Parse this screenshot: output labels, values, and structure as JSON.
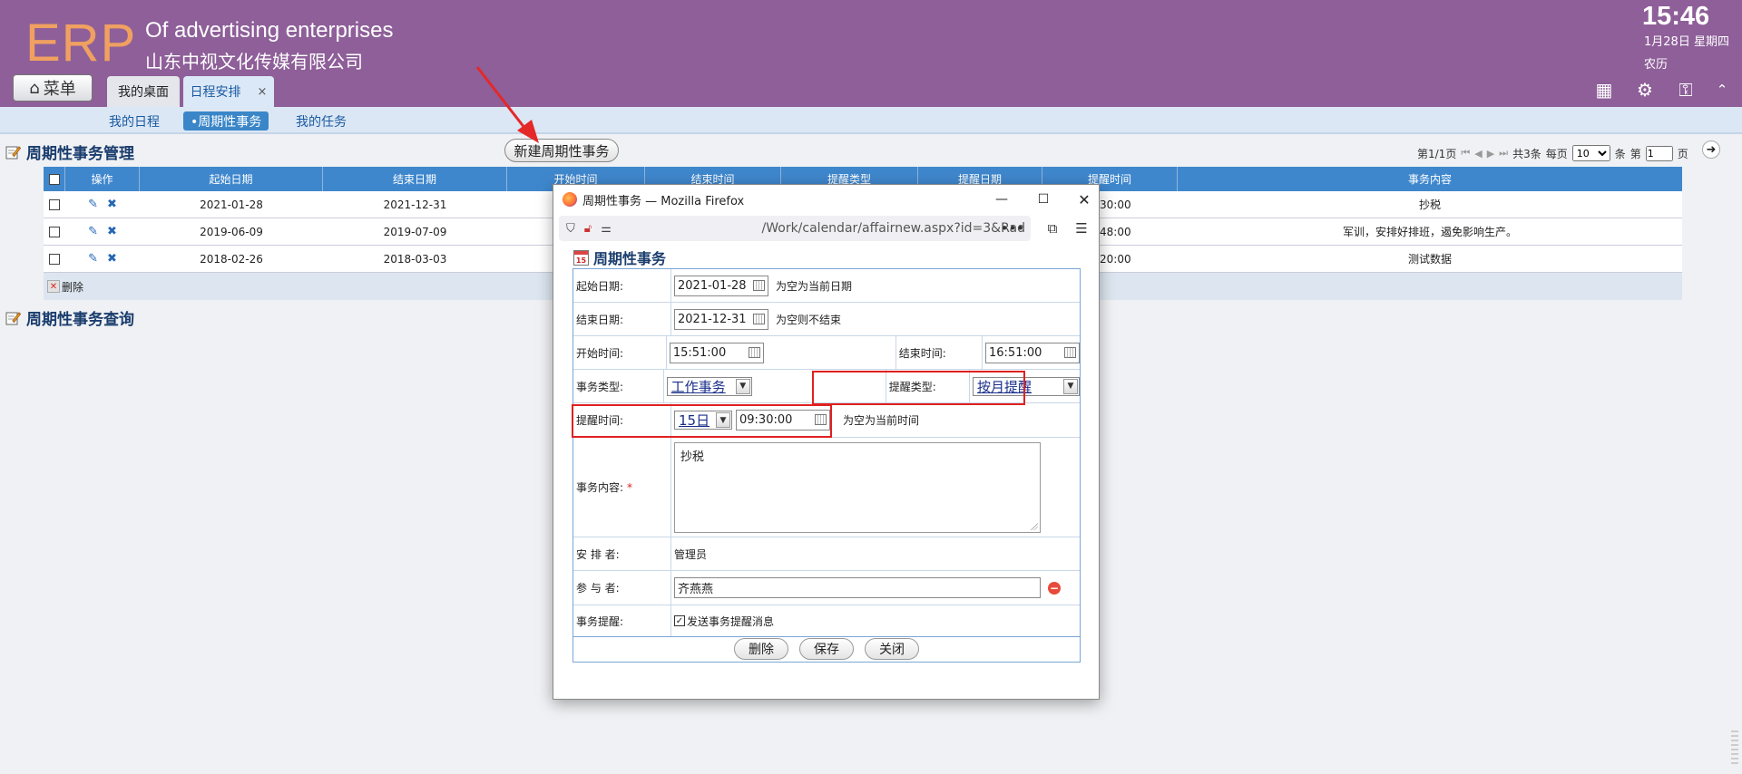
{
  "header": {
    "logo": "ERP",
    "brand_en": "Of advertising enterprises",
    "brand_cn": "山东中视文化传媒有限公司",
    "clock": "15:46",
    "date": "1月28日 星期四",
    "lunar": "农历",
    "menu_label": "菜单",
    "tabs": [
      {
        "label": "我的桌面"
      },
      {
        "label": "日程安排",
        "close": "×"
      }
    ],
    "icons": [
      "grid-add-icon",
      "gear-icon",
      "key-icon",
      "collapse-icon"
    ]
  },
  "subnav": {
    "items": [
      {
        "label": "我的日程"
      },
      {
        "label": "•周期性事务"
      },
      {
        "label": "我的任务"
      }
    ],
    "active": 1
  },
  "manage": {
    "title": "周期性事务管理",
    "new_button": "新建周期性事务",
    "pager": {
      "page": "第1/1页",
      "total": "共3条",
      "per_page_label": "每页",
      "per_page": "10",
      "unit": "条",
      "goto_prefix": "第",
      "goto_value": "1",
      "goto_suffix": "页"
    },
    "columns": [
      "操作",
      "起始日期",
      "结束日期",
      "开始时间",
      "结束时间",
      "提醒类型",
      "提醒日期",
      "提醒时间",
      "事务内容"
    ],
    "rows": [
      {
        "start": "2021-01-28",
        "end": "2021-12-31",
        "remind_time": "9:30:00",
        "content": "抄税"
      },
      {
        "start": "2019-06-09",
        "end": "2019-07-09",
        "remind_time": "7:48:00",
        "content": "军训，安排好排班，遏免影响生产。"
      },
      {
        "start": "2018-02-26",
        "end": "2018-03-03",
        "remind_time": "3:20:00",
        "content": "测试数据"
      }
    ],
    "delete_label": "删除"
  },
  "query": {
    "title": "周期性事务查询"
  },
  "popup": {
    "window_title": "周期性事务 — Mozilla Firefox",
    "url": "/Work/calendar/affairnew.aspx?id=3&Rad",
    "heading": "周期性事务",
    "fields": {
      "start_date_label": "起始日期:",
      "start_date": "2021-01-28",
      "start_date_hint": "为空为当前日期",
      "end_date_label": "结束日期:",
      "end_date": "2021-12-31",
      "end_date_hint": "为空则不结束",
      "start_time_label": "开始时间:",
      "start_time": "15:51:00",
      "end_time_label": "结束时间:",
      "end_time": "16:51:00",
      "affair_type_label": "事务类型:",
      "affair_type": "工作事务",
      "remind_type_label": "提醒类型:",
      "remind_type": "按月提醒",
      "remind_time_label": "提醒时间:",
      "remind_day": "15日",
      "remind_time": "09:30:00",
      "remind_time_hint": "为空为当前时间",
      "content_label": "事务内容:",
      "required_mark": "*",
      "content": "抄税",
      "arranger_label": "安 排 者:",
      "arranger": "管理员",
      "participant_label": "参 与 者:",
      "participant": "齐燕燕",
      "notify_label": "事务提醒:",
      "notify_text": "发送事务提醒消息"
    },
    "buttons": {
      "delete": "删除",
      "save": "保存",
      "close": "关闭"
    }
  },
  "colors": {
    "header_bg": "#8e5f99",
    "logo": "#f0a060",
    "table_header": "#3f87cd",
    "highlight_box": "#e02020"
  }
}
